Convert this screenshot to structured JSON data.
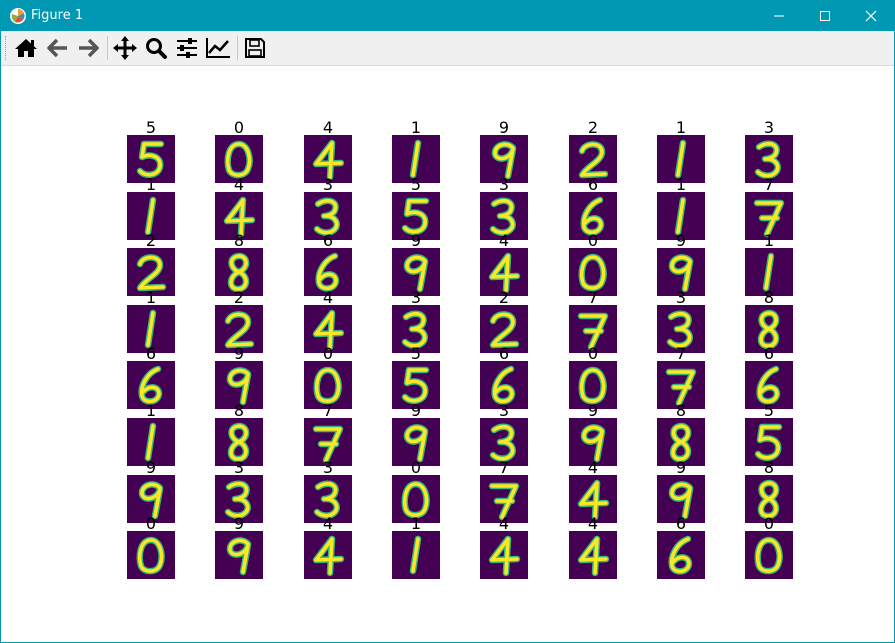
{
  "window": {
    "title": "Figure 1",
    "accent_color": "#0098b3",
    "app_icon": "matplotlib-icon",
    "controls": [
      "minimize-icon",
      "maximize-icon",
      "close-icon"
    ]
  },
  "toolbar": {
    "buttons": [
      {
        "name": "home",
        "icon": "home-icon"
      },
      {
        "name": "back",
        "icon": "arrow-left-icon"
      },
      {
        "name": "forward",
        "icon": "arrow-right-icon"
      },
      {
        "name": "pan",
        "icon": "move-icon"
      },
      {
        "name": "zoom",
        "icon": "magnifier-icon"
      },
      {
        "name": "subplots",
        "icon": "sliders-icon"
      },
      {
        "name": "edit-axes",
        "icon": "line-chart-icon"
      },
      {
        "name": "save",
        "icon": "floppy-disk-icon"
      }
    ]
  },
  "figure": {
    "colormap_bg": "#440154",
    "colormap_fg": "#fde725",
    "colormap_mid": "#35b779",
    "grid_rows": 8,
    "grid_cols": 8,
    "labels": [
      [
        "5",
        "0",
        "4",
        "1",
        "9",
        "2",
        "1",
        "3"
      ],
      [
        "1",
        "4",
        "3",
        "5",
        "3",
        "6",
        "1",
        "7"
      ],
      [
        "2",
        "8",
        "6",
        "9",
        "4",
        "0",
        "9",
        "1"
      ],
      [
        "1",
        "2",
        "4",
        "3",
        "2",
        "7",
        "3",
        "8"
      ],
      [
        "6",
        "9",
        "0",
        "5",
        "6",
        "0",
        "7",
        "6"
      ],
      [
        "1",
        "8",
        "7",
        "9",
        "3",
        "9",
        "8",
        "5"
      ],
      [
        "9",
        "3",
        "3",
        "0",
        "7",
        "4",
        "9",
        "8"
      ],
      [
        "0",
        "9",
        "4",
        "1",
        "4",
        "4",
        "6",
        "0"
      ]
    ]
  }
}
